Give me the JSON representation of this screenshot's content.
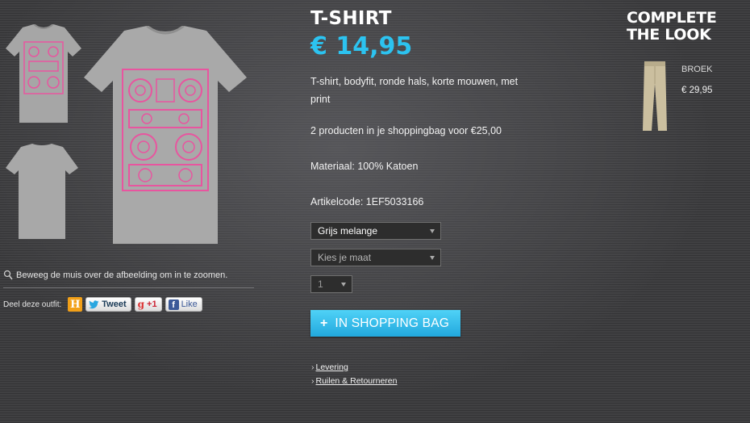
{
  "gallery": {
    "zoom_hint": "Beweeg de muis over de afbeelding om in te zoomen.",
    "share_label": "Deel deze outfit:",
    "hyves_letter": "H",
    "tweet_label": "Tweet",
    "gplus_label": "+1",
    "like_label": "Like",
    "accent_pink": "#e8559f",
    "shirt_gray": "#a9a9a9"
  },
  "product": {
    "title": "T-SHIRT",
    "price": "€ 14,95",
    "description": "T-shirt, bodyfit, ronde hals, korte mouwen, met print",
    "promo": "2 producten in je shoppingbag voor €25,00",
    "material": "Materiaal: 100% Katoen",
    "article_code": "Artikelcode: 1EF5033166",
    "color_select": "Grijs melange",
    "size_select": "Kies je maat",
    "qty_select": "1",
    "add_to_bag": "IN SHOPPING BAG",
    "accent_color": "#2cc3f0"
  },
  "links": {
    "delivery": "Levering",
    "returns": "Ruilen & Retourneren"
  },
  "look": {
    "heading": "COMPLETE THE LOOK",
    "item_name": "BROEK",
    "item_price": "€ 29,95"
  }
}
